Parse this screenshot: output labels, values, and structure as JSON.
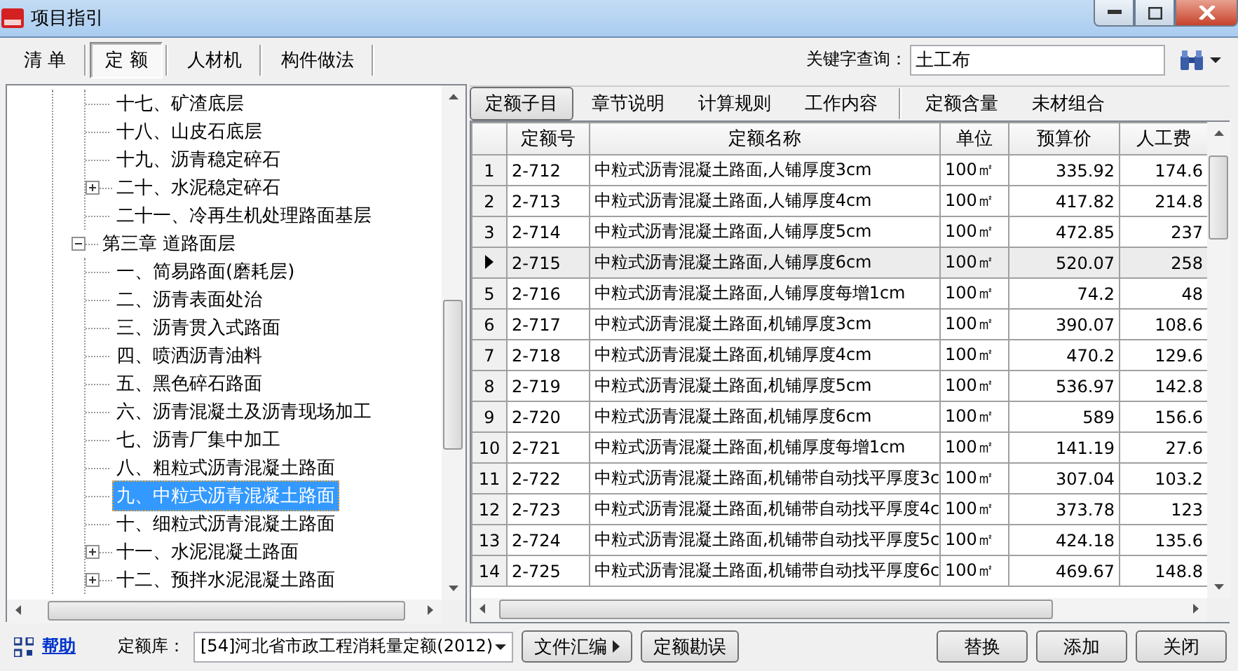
{
  "window": {
    "title": "项目指引"
  },
  "toolbar_tabs": [
    {
      "label": "清 单",
      "selected": false
    },
    {
      "label": "定 额",
      "selected": true
    },
    {
      "label": "人材机",
      "selected": false
    },
    {
      "label": "构件做法",
      "selected": false
    }
  ],
  "search": {
    "label": "关键字查询：",
    "value": "土工布"
  },
  "tree": [
    {
      "children": [
        {
          "label": "十七、矿渣底层",
          "selected": false
        },
        {
          "label": "十八、山皮石底层",
          "selected": false
        },
        {
          "label": "十九、沥青稳定碎石",
          "selected": false
        },
        {
          "label": "二十、水泥稳定碎石",
          "selected": false,
          "expanded": false
        },
        {
          "label": "二十一、冷再生机处理路面基层",
          "selected": false
        }
      ]
    },
    {
      "label": "第三章 道路面层",
      "selected": false,
      "expanded": true,
      "children": [
        {
          "label": "一、简易路面(磨耗层)",
          "selected": false
        },
        {
          "label": "二、沥青表面处治",
          "selected": false
        },
        {
          "label": "三、沥青贯入式路面",
          "selected": false
        },
        {
          "label": "四、喷洒沥青油料",
          "selected": false
        },
        {
          "label": "五、黑色碎石路面",
          "selected": false
        },
        {
          "label": "六、沥青混凝土及沥青现场加工",
          "selected": false
        },
        {
          "label": "七、沥青厂集中加工",
          "selected": false
        },
        {
          "label": "八、粗粒式沥青混凝土路面",
          "selected": false
        },
        {
          "label": "九、中粒式沥青混凝土路面",
          "selected": true
        },
        {
          "label": "十、细粒式沥青混凝土路面",
          "selected": false
        },
        {
          "label": "十一、水泥混凝土路面",
          "selected": false,
          "expanded": false
        },
        {
          "label": "十二、预拌水泥混凝土路面",
          "selected": false,
          "expanded": false
        }
      ]
    }
  ],
  "detail_tabs": [
    {
      "label": "定额子目",
      "selected": true,
      "separated": false
    },
    {
      "label": "章节说明",
      "selected": false,
      "separated": false
    },
    {
      "label": "计算规则",
      "selected": false,
      "separated": false
    },
    {
      "label": "工作内容",
      "selected": false,
      "separated": false
    },
    {
      "label": "定额含量",
      "selected": false,
      "separated": true
    },
    {
      "label": "未材组合",
      "selected": false,
      "separated": false
    }
  ],
  "table": {
    "columns": [
      "定额号",
      "定额名称",
      "单位",
      "预算价",
      "人工费"
    ],
    "rows": [
      {
        "num": "1",
        "cells": [
          "2-712",
          "中粒式沥青混凝土路面,人铺厚度3cm",
          "100㎡",
          "335.92",
          "174.6"
        ],
        "selected": false
      },
      {
        "num": "2",
        "cells": [
          "2-713",
          "中粒式沥青混凝土路面,人铺厚度4cm",
          "100㎡",
          "417.82",
          "214.8"
        ],
        "selected": false
      },
      {
        "num": "3",
        "cells": [
          "2-714",
          "中粒式沥青混凝土路面,人铺厚度5cm",
          "100㎡",
          "472.85",
          "237"
        ],
        "selected": false
      },
      {
        "cells": [
          "2-715",
          "中粒式沥青混凝土路面,人铺厚度6cm",
          "100㎡",
          "520.07",
          "258"
        ],
        "selected": true
      },
      {
        "num": "5",
        "cells": [
          "2-716",
          "中粒式沥青混凝土路面,人铺厚度每增1cm",
          "100㎡",
          "74.2",
          "48"
        ],
        "selected": false
      },
      {
        "num": "6",
        "cells": [
          "2-717",
          "中粒式沥青混凝土路面,机铺厚度3cm",
          "100㎡",
          "390.07",
          "108.6"
        ],
        "selected": false
      },
      {
        "num": "7",
        "cells": [
          "2-718",
          "中粒式沥青混凝土路面,机铺厚度4cm",
          "100㎡",
          "470.2",
          "129.6"
        ],
        "selected": false
      },
      {
        "num": "8",
        "cells": [
          "2-719",
          "中粒式沥青混凝土路面,机铺厚度5cm",
          "100㎡",
          "536.97",
          "142.8"
        ],
        "selected": false
      },
      {
        "num": "9",
        "cells": [
          "2-720",
          "中粒式沥青混凝土路面,机铺厚度6cm",
          "100㎡",
          "589",
          "156.6"
        ],
        "selected": false
      },
      {
        "num": "10",
        "cells": [
          "2-721",
          "中粒式沥青混凝土路面,机铺厚度每增1cm",
          "100㎡",
          "141.19",
          "27.6"
        ],
        "selected": false
      },
      {
        "num": "11",
        "cells": [
          "2-722",
          "中粒式沥青混凝土路面,机铺带自动找平厚度3c",
          "100㎡",
          "307.04",
          "103.2"
        ],
        "selected": false
      },
      {
        "num": "12",
        "cells": [
          "2-723",
          "中粒式沥青混凝土路面,机铺带自动找平厚度4c",
          "100㎡",
          "373.78",
          "123"
        ],
        "selected": false
      },
      {
        "num": "13",
        "cells": [
          "2-724",
          "中粒式沥青混凝土路面,机铺带自动找平厚度5c",
          "100㎡",
          "424.18",
          "135.6"
        ],
        "selected": false
      },
      {
        "num": "14",
        "cells": [
          "2-725",
          "中粒式沥青混凝土路面,机铺带自动找平厚度6c",
          "100㎡",
          "469.67",
          "148.8"
        ],
        "selected": false
      }
    ]
  },
  "footer": {
    "help": "帮助",
    "library_label": "定额库：",
    "library": "[54]河北省市政工程消耗量定额(2012)",
    "tools": [
      {
        "label": "文件汇编",
        "kind": "menu"
      },
      {
        "label": "定额勘误",
        "kind": "plain"
      }
    ],
    "actions": [
      "替换",
      "添加",
      "关闭"
    ]
  }
}
